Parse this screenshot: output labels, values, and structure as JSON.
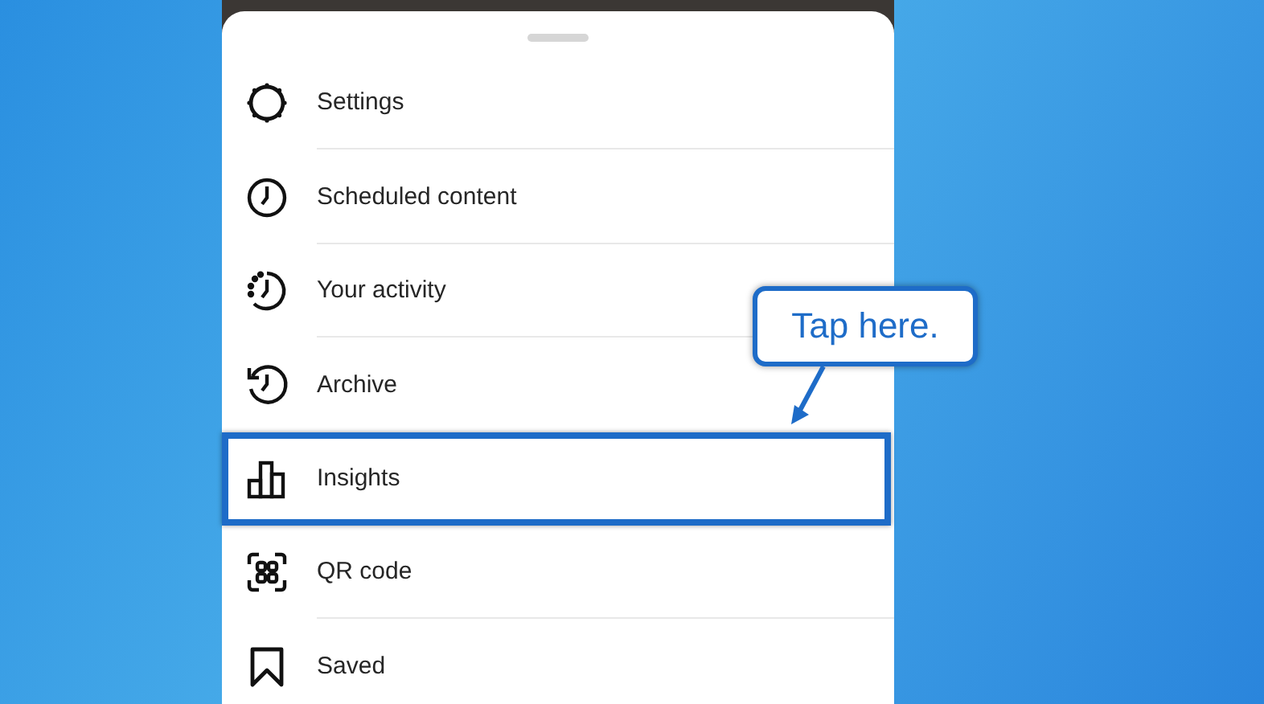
{
  "menu": {
    "items": [
      {
        "label": "Settings",
        "kind": "settings",
        "highlighted": false
      },
      {
        "label": "Scheduled content",
        "kind": "clock",
        "highlighted": false
      },
      {
        "label": "Your activity",
        "kind": "activity",
        "highlighted": false
      },
      {
        "label": "Archive",
        "kind": "archive",
        "highlighted": false
      },
      {
        "label": "Insights",
        "kind": "insights",
        "highlighted": true
      },
      {
        "label": "QR code",
        "kind": "qr",
        "highlighted": false
      },
      {
        "label": "Saved",
        "kind": "saved",
        "highlighted": false
      }
    ]
  },
  "callout": {
    "text": "Tap here."
  }
}
